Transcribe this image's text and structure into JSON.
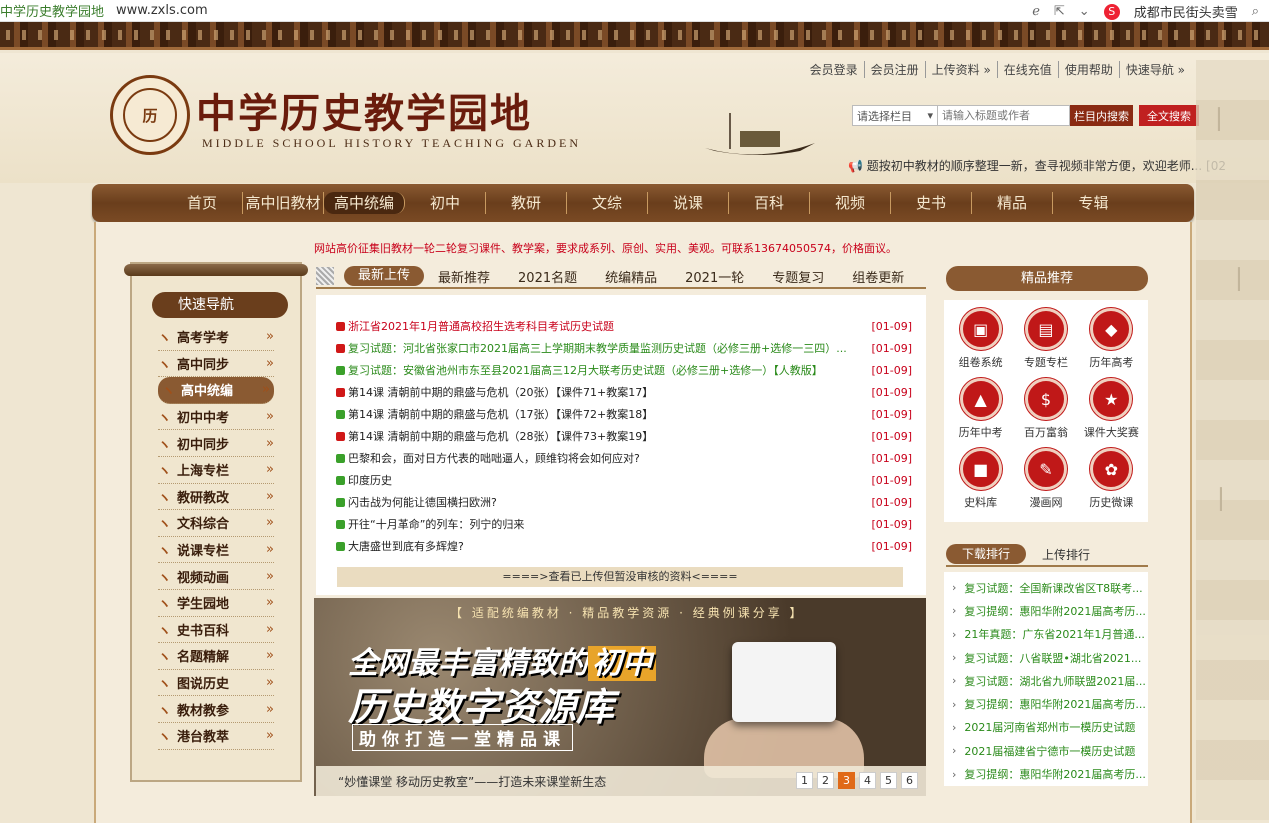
{
  "browser": {
    "site_name": "中学历史教学园地",
    "url": "www.zxls.com",
    "search_suggestion": "成都市民街头卖雪"
  },
  "header": {
    "top_links": [
      "会员登录",
      "会员注册",
      "上传资料 »",
      "在线充值",
      "使用帮助",
      "快速导航 »"
    ],
    "title": "中学历史教学园地",
    "subtitle": "MIDDLE SCHOOL HISTORY TEACHING GARDEN",
    "seal_text": "历",
    "search_select": "请选择栏目",
    "search_placeholder": "请输入标题或作者",
    "search_in_button": "栏目内搜索",
    "search_all_button": "全文搜索",
    "notice": "题按初中教材的顺序整理一新，查寻视频非常方便，欢迎老师... [02"
  },
  "nav": [
    "首页",
    "高中旧教材",
    "高中统编",
    "初中",
    "教研",
    "文综",
    "说课",
    "百科",
    "视频",
    "史书",
    "精品",
    "专辑"
  ],
  "ad_text": "网站高价征集旧教材一轮二轮复习课件、教学案，要求成系列、原创、实用、美观。可联系13674050574，价格面议。",
  "sidebar": {
    "title": "快速导航",
    "items": [
      "高考学考",
      "高中同步",
      "高中统编",
      "初中中考",
      "初中同步",
      "上海专栏",
      "教研教改",
      "文科综合",
      "说课专栏",
      "视频动画",
      "学生园地",
      "史书百科",
      "名题精解",
      "图说历史",
      "教材教参",
      "港台教萃"
    ]
  },
  "tabs": [
    "最新上传",
    "最新推荐",
    "2021名题",
    "统编精品",
    "2021一轮",
    "专题复习",
    "组卷更新"
  ],
  "news": [
    {
      "title": "浙江省2021年1月普通高校招生选考科目考试历史试题",
      "date": "[01-09]",
      "color": "#c8001a",
      "bullet": "#d01818"
    },
    {
      "title": "复习试题：河北省张家口市2021届高三上学期期末教学质量监测历史试题（必修三册+选修一三四）...",
      "date": "[01-09]",
      "color": "#2a8a1a",
      "bullet": "#d01818"
    },
    {
      "title": "复习试题：安徽省池州市东至县2021届高三12月大联考历史试题（必修三册+选修一）【人教版】",
      "date": "[01-09]",
      "color": "#2a8a1a",
      "bullet": "#3aa02a"
    },
    {
      "title": "第14课 清朝前中期的鼎盛与危机（20张）【课件71+教案17】",
      "date": "[01-09]",
      "color": "#222",
      "bullet": "#d01818"
    },
    {
      "title": "第14课 清朝前中期的鼎盛与危机（17张）【课件72+教案18】",
      "date": "[01-09]",
      "color": "#222",
      "bullet": "#3aa02a"
    },
    {
      "title": "第14课 清朝前中期的鼎盛与危机（28张）【课件73+教案19】",
      "date": "[01-09]",
      "color": "#222",
      "bullet": "#d01818"
    },
    {
      "title": "巴黎和会，面对日方代表的咄咄逼人，顾维钧将会如何应对?",
      "date": "[01-09]",
      "color": "#222",
      "bullet": "#3aa02a"
    },
    {
      "title": "印度历史",
      "date": "[01-09]",
      "color": "#222",
      "bullet": "#3aa02a"
    },
    {
      "title": "闪击战为何能让德国横扫欧洲?",
      "date": "[01-09]",
      "color": "#222",
      "bullet": "#3aa02a"
    },
    {
      "title": "开往“十月革命”的列车：列宁的归来",
      "date": "[01-09]",
      "color": "#222",
      "bullet": "#3aa02a"
    },
    {
      "title": "大唐盛世到底有多辉煌?",
      "date": "[01-09]",
      "color": "#222",
      "bullet": "#3aa02a"
    }
  ],
  "more_text": "====>查看已上传但暂没审核的资料<====",
  "banner": {
    "slogan": "【 适配统编教材 · 精品教学资源 · 经典例课分享 】",
    "line1_pre": "全网最丰富精致的",
    "line1_hl": "初中",
    "line2": "历史数字资源库",
    "line3": "助你打造一堂精品课",
    "caption": "“妙懂课堂 移动历史教室”——打造未来课堂新生态",
    "pages": [
      "1",
      "2",
      "3",
      "4",
      "5",
      "6"
    ],
    "active_page": "3"
  },
  "right": {
    "head": "精品推荐",
    "features": [
      {
        "label": "组卷系统",
        "icon": "▣"
      },
      {
        "label": "专题专栏",
        "icon": "▤"
      },
      {
        "label": "历年高考",
        "icon": "◆"
      },
      {
        "label": "历年中考",
        "icon": "▲"
      },
      {
        "label": "百万富翁",
        "icon": "$"
      },
      {
        "label": "课件大奖赛",
        "icon": "★"
      },
      {
        "label": "史料库",
        "icon": "■"
      },
      {
        "label": "漫画网",
        "icon": "✎"
      },
      {
        "label": "历史微课",
        "icon": "✿"
      }
    ],
    "rank_tabs": [
      "下载排行",
      "上传排行"
    ],
    "ranks": [
      "复习试题：全国新课改省区T8联考...",
      "复习提纲：惠阳华附2021届高考历...",
      "21年真题：广东省2021年1月普通...",
      "复习试题：八省联盟•湖北省2021...",
      "复习试题：湖北省九师联盟2021届...",
      "复习提纲：惠阳华附2021届高考历...",
      "2021届河南省郑州市一模历史试题",
      "2021届福建省宁德市一模历史试题",
      "复习提纲：惠阳华附2021届高考历..."
    ]
  }
}
